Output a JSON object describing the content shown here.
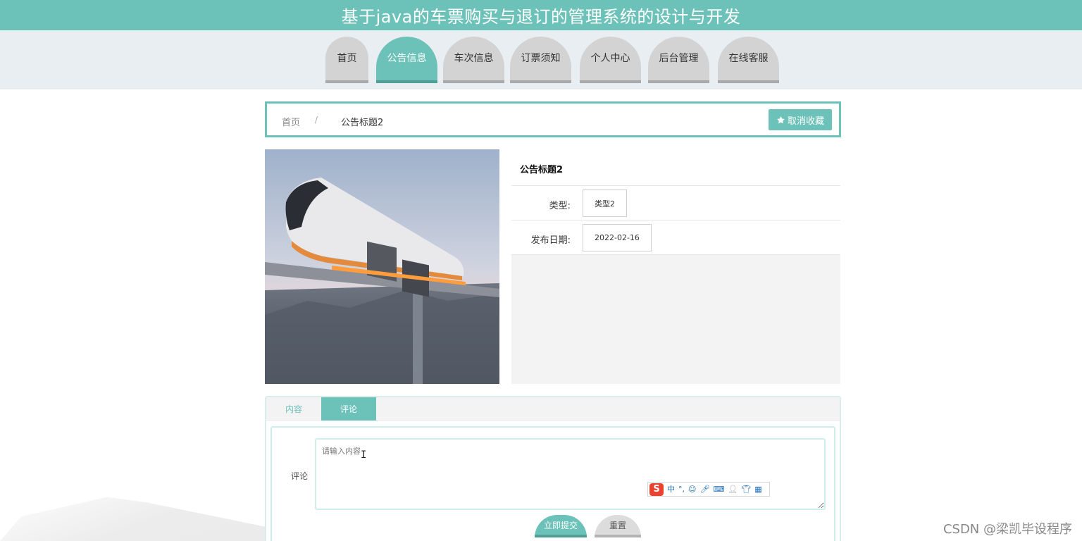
{
  "header": {
    "title": "基于java的车票购买与退订的管理系统的设计与开发"
  },
  "nav": {
    "items": [
      {
        "label": "首页",
        "active": false
      },
      {
        "label": "公告信息",
        "active": true
      },
      {
        "label": "车次信息",
        "active": false
      },
      {
        "label": "订票须知",
        "active": false
      },
      {
        "label": "个人中心",
        "active": false
      },
      {
        "label": "后台管理",
        "active": false
      },
      {
        "label": "在线客服",
        "active": false
      }
    ]
  },
  "breadcrumb": {
    "home": "首页",
    "separator": "/",
    "current": "公告标题2",
    "favorite_button": "取消收藏"
  },
  "detail": {
    "title": "公告标题2",
    "fields": [
      {
        "label": "类型:",
        "value": "类型2"
      },
      {
        "label": "发布日期:",
        "value": "2022-02-16"
      }
    ]
  },
  "tabs": {
    "items": [
      {
        "label": "内容",
        "active": false
      },
      {
        "label": "评论",
        "active": true
      }
    ]
  },
  "comment_form": {
    "label": "评论",
    "placeholder": "请输入内容",
    "submit_label": "立即提交",
    "reset_label": "重置"
  },
  "ime_toolbar": {
    "logo": "S",
    "mode": "中"
  },
  "watermark": "CSDN @梁凯毕设程序",
  "colors": {
    "accent": "#6cc2b9",
    "accent_dark": "#4f9f97",
    "nav_inactive": "#d3d3d3",
    "nav_band": "#e8eef1"
  }
}
